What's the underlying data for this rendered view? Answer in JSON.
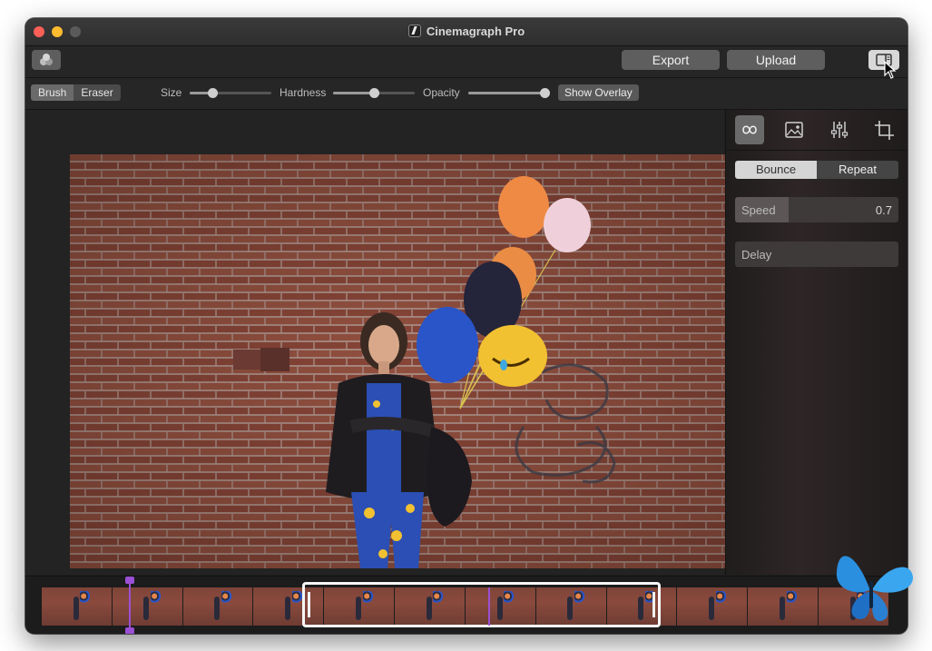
{
  "window": {
    "title": "Cinemagraph Pro"
  },
  "toolbar": {
    "export_label": "Export",
    "upload_label": "Upload"
  },
  "brush_tools": {
    "brush_label": "Brush",
    "eraser_label": "Eraser",
    "selected": "Brush",
    "size_label": "Size",
    "size_value": 0.28,
    "hardness_label": "Hardness",
    "hardness_value": 0.5,
    "opacity_label": "Opacity",
    "opacity_value": 1.0,
    "show_overlay_label": "Show Overlay"
  },
  "sidebar": {
    "tabs": [
      {
        "name": "loop",
        "icon": "infinity-icon",
        "active": true
      },
      {
        "name": "image",
        "icon": "image-icon",
        "active": false
      },
      {
        "name": "adjust",
        "icon": "sliders-icon",
        "active": false
      },
      {
        "name": "crop",
        "icon": "crop-icon",
        "active": false
      }
    ],
    "loop_modes": {
      "bounce_label": "Bounce",
      "repeat_label": "Repeat",
      "selected": "Bounce"
    },
    "speed": {
      "label": "Speed",
      "value": "0.7",
      "fraction": 0.33
    },
    "delay": {
      "label": "Delay"
    }
  },
  "colors": {
    "accent_playhead": "#9b4fd4",
    "window_bg": "#1e1e1e"
  }
}
